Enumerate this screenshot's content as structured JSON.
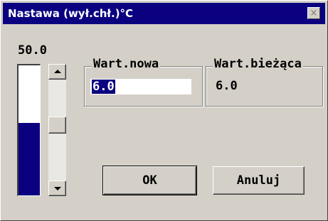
{
  "window": {
    "title": "Nastawa (wył.chł.)°C",
    "close_glyph": "×"
  },
  "gauge": {
    "value_label": "50.0",
    "fill_fraction": 0.56,
    "fill_color": "#0a0080"
  },
  "new_value": {
    "legend": "Wart.nowa",
    "value": "6.0"
  },
  "current_value": {
    "legend": "Wart.bieżąca",
    "value": "6.0"
  },
  "buttons": {
    "ok": "OK",
    "cancel": "Anuluj"
  },
  "colors": {
    "titlebar": "#0a0080",
    "face": "#d4d0c8",
    "selection": "#0a0080"
  }
}
